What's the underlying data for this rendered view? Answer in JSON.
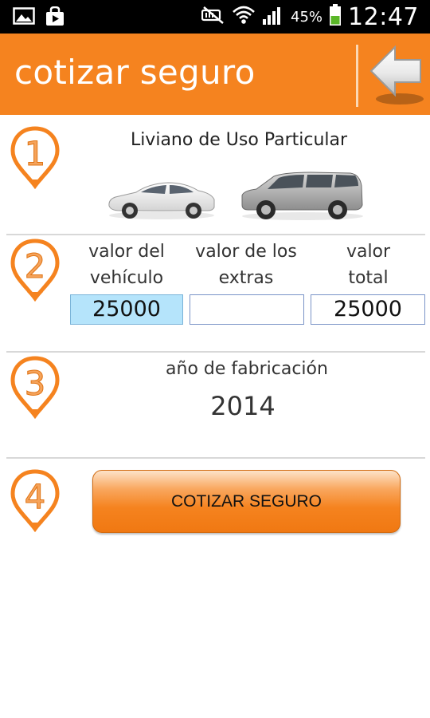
{
  "status_bar": {
    "battery_percent": "45%",
    "time": "12:47",
    "icons": [
      "gallery-icon",
      "shopping-bag-icon",
      "mute-icon",
      "wifi-icon",
      "signal-icon",
      "battery-icon"
    ]
  },
  "app_bar": {
    "title": "cotizar seguro",
    "back_icon": "back-arrow-icon",
    "color": "#f5831f"
  },
  "step1": {
    "number": "1",
    "title": "Liviano de Uso Particular",
    "vehicles": [
      "sedan-icon",
      "suv-icon"
    ]
  },
  "step2": {
    "number": "2",
    "columns": [
      {
        "label_line1": "valor del",
        "label_line2": "vehículo",
        "value": "25000"
      },
      {
        "label_line1": "valor de los",
        "label_line2": "extras",
        "value": ""
      },
      {
        "label_line1": "valor",
        "label_line2": "total",
        "value": "25000"
      }
    ]
  },
  "step3": {
    "number": "3",
    "title": "año de fabricación",
    "value": "2014"
  },
  "step4": {
    "number": "4",
    "button_label": "COTIZAR SEGURO"
  },
  "colors": {
    "accent": "#f5831f",
    "input_active": "#b5e4fb"
  }
}
